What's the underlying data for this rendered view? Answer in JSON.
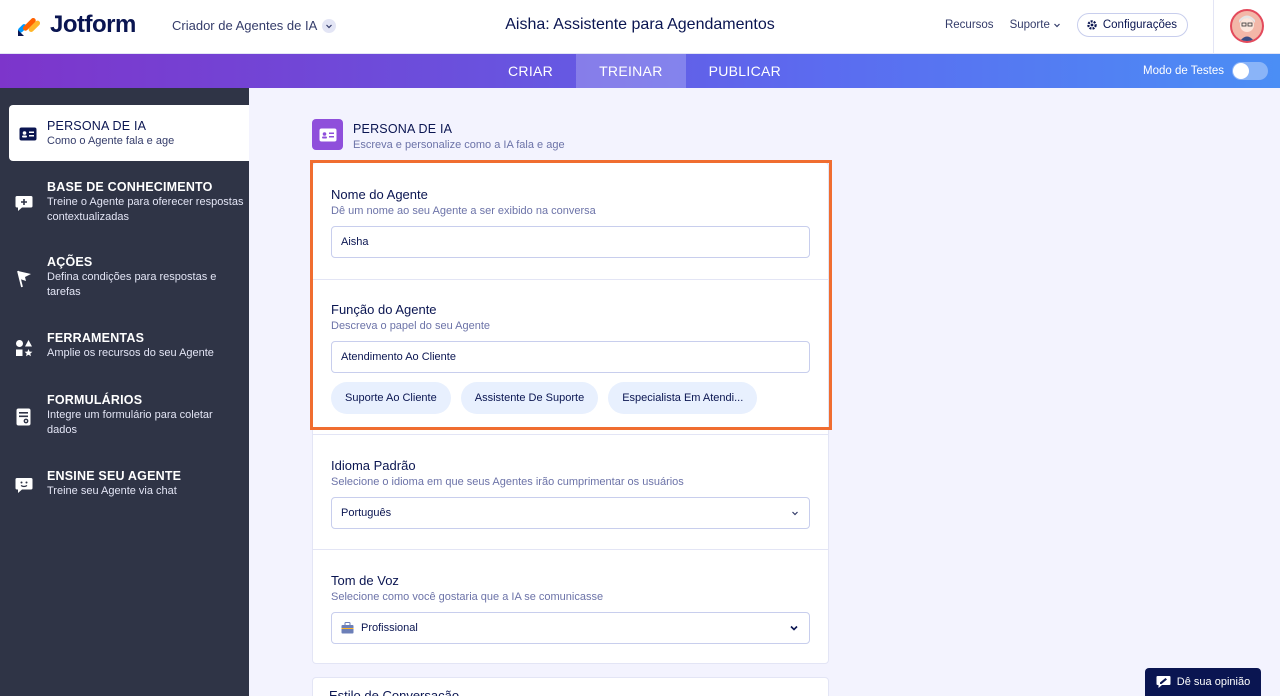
{
  "header": {
    "logo_text": "Jotform",
    "builder_label": "Criador de Agentes de IA",
    "title": "Aisha: Assistente para Agendamentos",
    "links": {
      "resources": "Recursos",
      "support": "Suporte",
      "settings": "Configurações"
    }
  },
  "tabs": {
    "create": "CRIAR",
    "train": "TREINAR",
    "publish": "PUBLICAR",
    "active": "TREINAR"
  },
  "test_mode": {
    "label": "Modo de Testes",
    "enabled": false
  },
  "sidebar": {
    "items": [
      {
        "title": "PERSONA DE IA",
        "subtitle": "Como o Agente fala e age",
        "icon": "id-card-icon",
        "active": true
      },
      {
        "title": "BASE DE CONHECIMENTO",
        "subtitle": "Treine o Agente para oferecer respostas contextualizadas",
        "icon": "chat-plus-icon"
      },
      {
        "title": "AÇÕES",
        "subtitle": "Defina condições para respostas e tarefas",
        "icon": "flag-icon"
      },
      {
        "title": "FERRAMENTAS",
        "subtitle": "Amplie os recursos do seu Agente",
        "icon": "shapes-icon"
      },
      {
        "title": "FORMULÁRIOS",
        "subtitle": "Integre um formulário para coletar dados",
        "icon": "form-icon"
      },
      {
        "title": "ENSINE SEU AGENTE",
        "subtitle": "Treine seu Agente via chat",
        "icon": "chat-smile-icon"
      }
    ]
  },
  "main": {
    "section": {
      "title": "PERSONA DE IA",
      "subtitle": "Escreva e personalize como a IA fala e age"
    },
    "agent_name": {
      "label": "Nome do Agente",
      "hint": "Dê um nome ao seu Agente a ser exibido na conversa",
      "value": "Aisha"
    },
    "agent_role": {
      "label": "Função do Agente",
      "hint": "Descreva o papel do seu Agente",
      "value": "Atendimento Ao Cliente",
      "suggestions": [
        "Suporte Ao Cliente",
        "Assistente De Suporte",
        "Especialista Em Atendi..."
      ]
    },
    "language": {
      "label": "Idioma Padrão",
      "hint": "Selecione o idioma em que seus Agentes irão cumprimentar os usuários",
      "value": "Português"
    },
    "tone": {
      "label": "Tom de Voz",
      "hint": "Selecione como você gostaria que a IA se comunicasse",
      "value": "Profissional",
      "icon": "briefcase-icon"
    },
    "next_section_label": "Estilo de Conversação"
  },
  "feedback": {
    "label": "Dê sua opinião"
  },
  "colors": {
    "accent": "#f06d30",
    "sidebar_bg": "#2f3446",
    "brand_purple": "#7d35cb",
    "page_bg": "#f3f3fe"
  }
}
